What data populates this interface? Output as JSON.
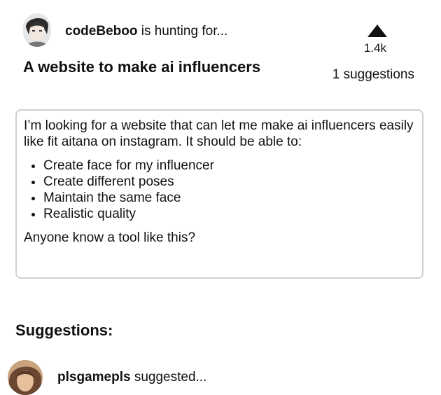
{
  "post": {
    "author": "codeBeboo",
    "author_suffix": "is hunting for...",
    "title": "A website to make ai influencers",
    "upvotes": "1.4k",
    "suggestion_count": "1 suggestions",
    "body": {
      "intro": "I’m looking for a website that can let me make ai influencers easily like fit aitana on instagram. It should be able to:",
      "bullets": [
        "Create face for my influencer",
        "Create different poses",
        "Maintain the same face",
        "Realistic quality"
      ],
      "outro": "Anyone know a tool like this?"
    }
  },
  "suggestions": {
    "heading": "Suggestions:",
    "items": [
      {
        "user": "plsgamepls",
        "suffix": "suggested..."
      }
    ]
  },
  "icons": {
    "upvote": "triangle-up-icon"
  }
}
